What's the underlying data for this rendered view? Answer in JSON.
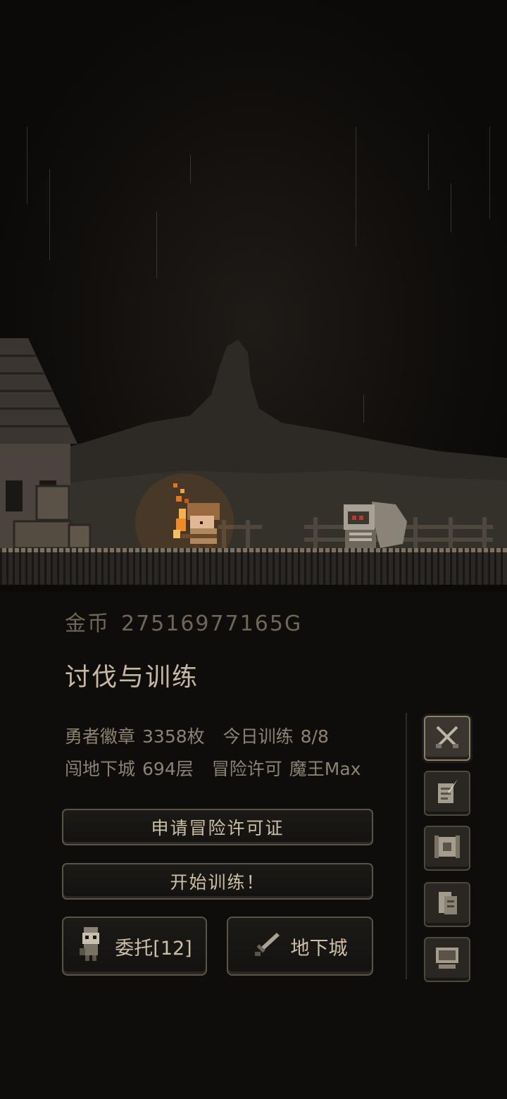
{
  "gold": {
    "label": "金币",
    "value": "275169771​65G"
  },
  "section_title": "讨伐与训练",
  "stats": {
    "badge_label": "勇者徽章",
    "badge_value": "3358枚",
    "training_label": "今日训练",
    "training_value": "8/8",
    "dungeon_label": "闯地下城",
    "dungeon_value": "694层",
    "license_label": "冒险许可",
    "license_value": "魔王Max"
  },
  "buttons": {
    "apply_license": "申请冒险许可证",
    "start_training": "开始训练！",
    "commission": "委托[12]",
    "dungeon": "地下城"
  },
  "side_menu": [
    "crossed-swords-icon",
    "scroll-quill-icon",
    "map-icon",
    "document-icon",
    "computer-icon"
  ],
  "colors": {
    "background": "#0b0a09",
    "text": "#c8baa2",
    "fire": "#e2761b",
    "enemy_eye": "#c0392b"
  }
}
